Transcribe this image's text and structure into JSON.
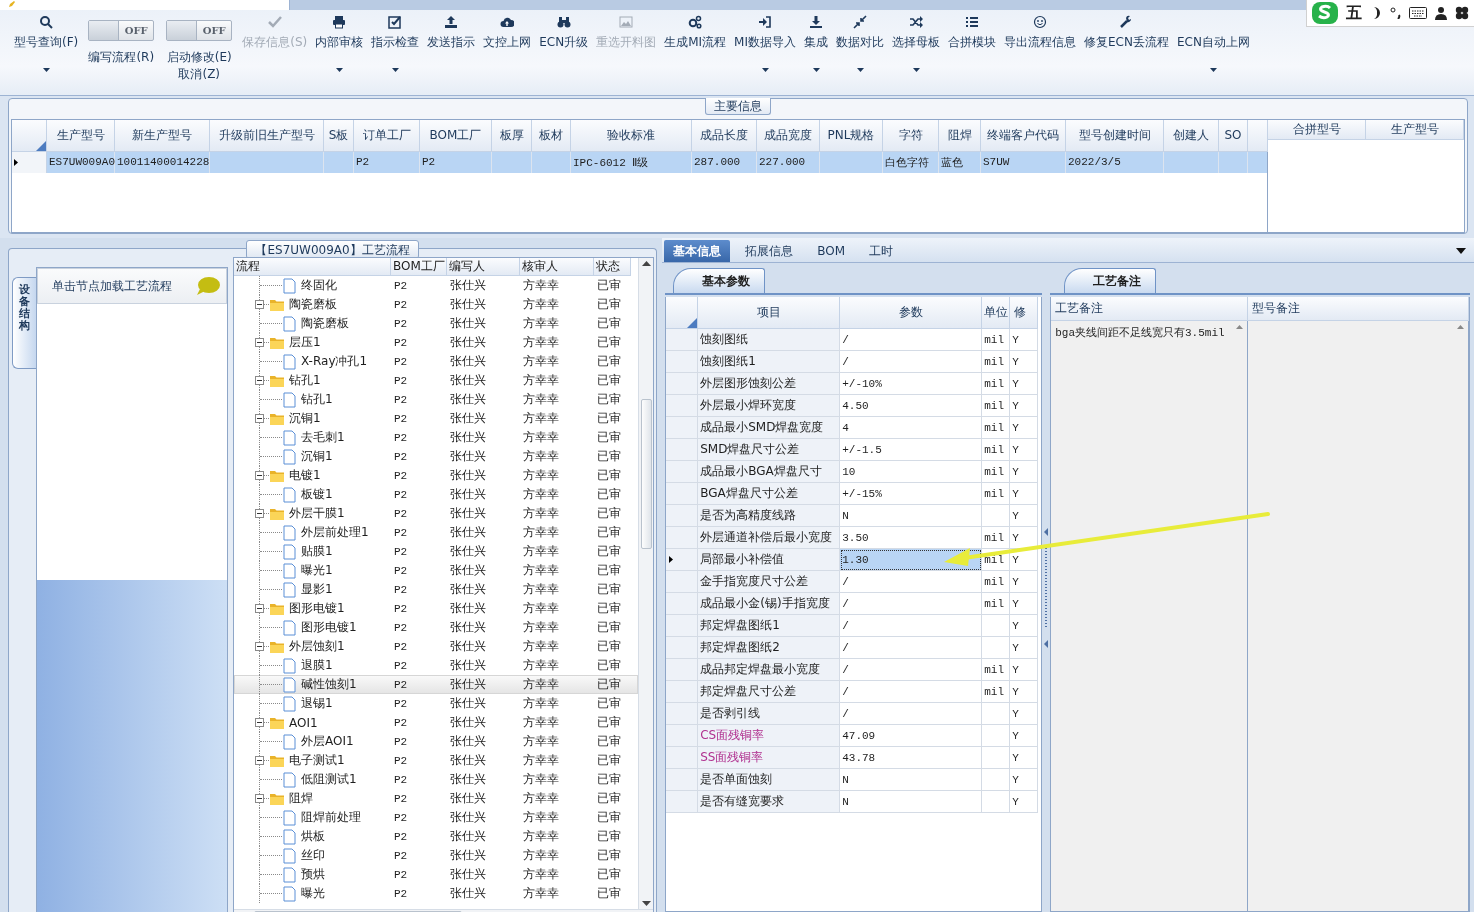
{
  "toolbar": {
    "items": [
      {
        "kind": "button",
        "label": "型号查询(F)",
        "dropdown": true,
        "disabled": false
      },
      {
        "kind": "toggle",
        "label": "编写流程(R)",
        "state_text": "OFF",
        "on": false
      },
      {
        "kind": "toggle",
        "label": "启动修改(E)",
        "sublabel": "取消(Z)",
        "state_text": "OFF",
        "on": false
      },
      {
        "kind": "button",
        "label": "保存信息(S)",
        "dropdown": false,
        "disabled": true
      },
      {
        "kind": "button",
        "label": "内部审核",
        "dropdown": true,
        "disabled": false
      },
      {
        "kind": "button",
        "label": "指示检查",
        "dropdown": true,
        "disabled": false
      },
      {
        "kind": "button",
        "label": "发送指示",
        "dropdown": false,
        "disabled": false
      },
      {
        "kind": "button",
        "label": "文控上网",
        "dropdown": false,
        "disabled": false
      },
      {
        "kind": "button",
        "label": "ECN升级",
        "dropdown": false,
        "disabled": false
      },
      {
        "kind": "button",
        "label": "重选开料图",
        "dropdown": false,
        "disabled": true
      },
      {
        "kind": "button",
        "label": "生成MI流程",
        "dropdown": false,
        "disabled": false
      },
      {
        "kind": "button",
        "label": "MI数据导入",
        "dropdown": true,
        "disabled": false
      },
      {
        "kind": "button",
        "label": "集成",
        "dropdown": true,
        "disabled": false
      },
      {
        "kind": "button",
        "label": "数据对比",
        "dropdown": true,
        "disabled": false
      },
      {
        "kind": "button",
        "label": "选择母板",
        "dropdown": true,
        "disabled": false
      },
      {
        "kind": "button",
        "label": "合拼模块",
        "dropdown": false,
        "disabled": false
      },
      {
        "kind": "button",
        "label": "导出流程信息",
        "dropdown": false,
        "disabled": false
      },
      {
        "kind": "button",
        "label": "修复ECN丢流程",
        "dropdown": false,
        "disabled": false
      },
      {
        "kind": "button",
        "label": "ECN自动上网",
        "dropdown": true,
        "disabled": false
      }
    ]
  },
  "ime_bar": {
    "mode": "五"
  },
  "main_info": {
    "title": "主要信息",
    "columns": [
      "生产型号",
      "新生产型号",
      "升级前旧生产型号",
      "S板",
      "订单工厂",
      "BOM工厂",
      "板厚",
      "板材",
      "验收标准",
      "成品长度",
      "成品宽度",
      "PNL规格",
      "字符",
      "阻焊",
      "终端客户代码",
      "型号创建时间",
      "创建人",
      "SO"
    ],
    "rows": [
      {
        "selected": true,
        "cells": [
          "ES7UW009A0",
          "10011400014228",
          null,
          null,
          "P2",
          "P2",
          null,
          null,
          "IPC-6012 Ⅱ级",
          "287.000",
          "227.000",
          null,
          "白色字符",
          "蓝色",
          "S7UW",
          "2022/3/5",
          null,
          null
        ]
      }
    ],
    "side_columns": [
      "合拼型号",
      "生产型号"
    ]
  },
  "process_flow": {
    "title": "【ES7UW009A0】工艺流程",
    "side_tab": "设备结构",
    "hint": "单击节点加载工艺流程",
    "columns": [
      "流程",
      "BOM工厂",
      "编写人",
      "核审人",
      "状态"
    ],
    "leading_rows": [
      {
        "name": "终固化",
        "kind": "file",
        "bom": "P2",
        "writer": "张仕兴",
        "reviewer": "方幸幸",
        "status": "已审",
        "selected": false
      }
    ],
    "nodes": [
      {
        "name": "陶瓷磨板",
        "kind": "folder",
        "expanded": true,
        "bom": "P2",
        "writer": "张仕兴",
        "reviewer": "方幸幸",
        "status": "已审",
        "selected": false,
        "children": [
          {
            "name": "陶瓷磨板",
            "kind": "file",
            "bom": "P2",
            "writer": "张仕兴",
            "reviewer": "方幸幸",
            "status": "已审",
            "selected": false
          }
        ]
      },
      {
        "name": "层压1",
        "kind": "folder",
        "expanded": true,
        "bom": "P2",
        "writer": "张仕兴",
        "reviewer": "方幸幸",
        "status": "已审",
        "selected": false,
        "children": [
          {
            "name": "X-Ray冲孔1",
            "kind": "file",
            "bom": "P2",
            "writer": "张仕兴",
            "reviewer": "方幸幸",
            "status": "已审",
            "selected": false
          }
        ]
      },
      {
        "name": "钻孔1",
        "kind": "folder",
        "expanded": true,
        "bom": "P2",
        "writer": "张仕兴",
        "reviewer": "方幸幸",
        "status": "已审",
        "selected": false,
        "children": [
          {
            "name": "钻孔1",
            "kind": "file",
            "bom": "P2",
            "writer": "张仕兴",
            "reviewer": "方幸幸",
            "status": "已审",
            "selected": false
          }
        ]
      },
      {
        "name": "沉铜1",
        "kind": "folder",
        "expanded": true,
        "bom": "P2",
        "writer": "张仕兴",
        "reviewer": "方幸幸",
        "status": "已审",
        "selected": false,
        "children": [
          {
            "name": "去毛刺1",
            "kind": "file",
            "bom": "P2",
            "writer": "张仕兴",
            "reviewer": "方幸幸",
            "status": "已审",
            "selected": false
          },
          {
            "name": "沉铜1",
            "kind": "file",
            "bom": "P2",
            "writer": "张仕兴",
            "reviewer": "方幸幸",
            "status": "已审",
            "selected": false
          }
        ]
      },
      {
        "name": "电镀1",
        "kind": "folder",
        "expanded": true,
        "bom": "P2",
        "writer": "张仕兴",
        "reviewer": "方幸幸",
        "status": "已审",
        "selected": false,
        "children": [
          {
            "name": "板镀1",
            "kind": "file",
            "bom": "P2",
            "writer": "张仕兴",
            "reviewer": "方幸幸",
            "status": "已审",
            "selected": false
          }
        ]
      },
      {
        "name": "外层干膜1",
        "kind": "folder",
        "expanded": true,
        "bom": "P2",
        "writer": "张仕兴",
        "reviewer": "方幸幸",
        "status": "已审",
        "selected": false,
        "children": [
          {
            "name": "外层前处理1",
            "kind": "file",
            "bom": "P2",
            "writer": "张仕兴",
            "reviewer": "方幸幸",
            "status": "已审",
            "selected": false
          },
          {
            "name": "贴膜1",
            "kind": "file",
            "bom": "P2",
            "writer": "张仕兴",
            "reviewer": "方幸幸",
            "status": "已审",
            "selected": false
          },
          {
            "name": "曝光1",
            "kind": "file",
            "bom": "P2",
            "writer": "张仕兴",
            "reviewer": "方幸幸",
            "status": "已审",
            "selected": false
          },
          {
            "name": "显影1",
            "kind": "file",
            "bom": "P2",
            "writer": "张仕兴",
            "reviewer": "方幸幸",
            "status": "已审",
            "selected": false
          }
        ]
      },
      {
        "name": "图形电镀1",
        "kind": "folder",
        "expanded": true,
        "bom": "P2",
        "writer": "张仕兴",
        "reviewer": "方幸幸",
        "status": "已审",
        "selected": false,
        "children": [
          {
            "name": "图形电镀1",
            "kind": "file",
            "bom": "P2",
            "writer": "张仕兴",
            "reviewer": "方幸幸",
            "status": "已审",
            "selected": false
          }
        ]
      },
      {
        "name": "外层蚀刻1",
        "kind": "folder",
        "expanded": true,
        "bom": "P2",
        "writer": "张仕兴",
        "reviewer": "方幸幸",
        "status": "已审",
        "selected": false,
        "children": [
          {
            "name": "退膜1",
            "kind": "file",
            "bom": "P2",
            "writer": "张仕兴",
            "reviewer": "方幸幸",
            "status": "已审",
            "selected": false
          },
          {
            "name": "碱性蚀刻1",
            "kind": "file",
            "bom": "P2",
            "writer": "张仕兴",
            "reviewer": "方幸幸",
            "status": "已审",
            "selected": true
          },
          {
            "name": "退锡1",
            "kind": "file",
            "bom": "P2",
            "writer": "张仕兴",
            "reviewer": "方幸幸",
            "status": "已审",
            "selected": false
          }
        ]
      },
      {
        "name": "AOI1",
        "kind": "folder",
        "expanded": true,
        "bom": "P2",
        "writer": "张仕兴",
        "reviewer": "方幸幸",
        "status": "已审",
        "selected": false,
        "children": [
          {
            "name": "外层AOI1",
            "kind": "file",
            "bom": "P2",
            "writer": "张仕兴",
            "reviewer": "方幸幸",
            "status": "已审",
            "selected": false
          }
        ]
      },
      {
        "name": "电子测试1",
        "kind": "folder",
        "expanded": true,
        "bom": "P2",
        "writer": "张仕兴",
        "reviewer": "方幸幸",
        "status": "已审",
        "selected": false,
        "children": [
          {
            "name": "低阻测试1",
            "kind": "file",
            "bom": "P2",
            "writer": "张仕兴",
            "reviewer": "方幸幸",
            "status": "已审",
            "selected": false
          }
        ]
      },
      {
        "name": "阻焊",
        "kind": "folder",
        "expanded": true,
        "bom": "P2",
        "writer": "张仕兴",
        "reviewer": "方幸幸",
        "status": "已审",
        "selected": false,
        "children": [
          {
            "name": "阻焊前处理",
            "kind": "file",
            "bom": "P2",
            "writer": "张仕兴",
            "reviewer": "方幸幸",
            "status": "已审",
            "selected": false
          },
          {
            "name": "烘板",
            "kind": "file",
            "bom": "P2",
            "writer": "张仕兴",
            "reviewer": "方幸幸",
            "status": "已审",
            "selected": false
          },
          {
            "name": "丝印",
            "kind": "file",
            "bom": "P2",
            "writer": "张仕兴",
            "reviewer": "方幸幸",
            "status": "已审",
            "selected": false
          },
          {
            "name": "预烘",
            "kind": "file",
            "bom": "P2",
            "writer": "张仕兴",
            "reviewer": "方幸幸",
            "status": "已审",
            "selected": false
          },
          {
            "name": "曝光",
            "kind": "file",
            "bom": "P2",
            "writer": "张仕兴",
            "reviewer": "方幸幸",
            "status": "已审",
            "selected": false
          }
        ]
      }
    ]
  },
  "detail": {
    "tabs": [
      {
        "label": "基本信息",
        "selected": true
      },
      {
        "label": "拓展信息",
        "selected": false
      },
      {
        "label": "BOM",
        "selected": false
      },
      {
        "label": "工时",
        "selected": false
      }
    ],
    "params": {
      "tab": "基本参数",
      "columns": [
        "项目",
        "参数",
        "单位",
        "修"
      ],
      "rows": [
        {
          "item": "蚀刻图纸",
          "value": "/",
          "unit": "mil",
          "flag": "Y",
          "highlighted": false,
          "selected": false
        },
        {
          "item": "蚀刻图纸1",
          "value": "/",
          "unit": "mil",
          "flag": "Y",
          "highlighted": false,
          "selected": false
        },
        {
          "item": "外层图形蚀刻公差",
          "value": "+/-10%",
          "unit": "mil",
          "flag": "Y",
          "highlighted": false,
          "selected": false
        },
        {
          "item": "外层最小焊环宽度",
          "value": "4.50",
          "unit": "mil",
          "flag": "Y",
          "highlighted": false,
          "selected": false
        },
        {
          "item": "成品最小SMD焊盘宽度",
          "value": "4",
          "unit": "mil",
          "flag": "Y",
          "highlighted": false,
          "selected": false
        },
        {
          "item": "SMD焊盘尺寸公差",
          "value": "+/-1.5",
          "unit": "mil",
          "flag": "Y",
          "highlighted": false,
          "selected": false
        },
        {
          "item": "成品最小BGA焊盘尺寸",
          "value": "10",
          "unit": "mil",
          "flag": "Y",
          "highlighted": false,
          "selected": false
        },
        {
          "item": "BGA焊盘尺寸公差",
          "value": "+/-15%",
          "unit": "mil",
          "flag": "Y",
          "highlighted": false,
          "selected": false
        },
        {
          "item": "是否为高精度线路",
          "value": "N",
          "flag": "Y",
          "highlighted": false,
          "selected": false
        },
        {
          "item": "外层通道补偿后最小宽度",
          "value": "3.50",
          "unit": "mil",
          "flag": "Y",
          "highlighted": false,
          "selected": false
        },
        {
          "item": "局部最小补偿值",
          "value": "1.30",
          "unit": "mil",
          "flag": "Y",
          "highlighted": false,
          "selected": true
        },
        {
          "item": "金手指宽度尺寸公差",
          "value": "/",
          "unit": "mil",
          "flag": "Y",
          "highlighted": false,
          "selected": false
        },
        {
          "item": "成品最小金(锡)手指宽度",
          "value": "/",
          "unit": "mil",
          "flag": "Y",
          "highlighted": false,
          "selected": false
        },
        {
          "item": "邦定焊盘图纸1",
          "value": "/",
          "flag": "Y",
          "highlighted": false,
          "selected": false
        },
        {
          "item": "邦定焊盘图纸2",
          "value": "/",
          "flag": "Y",
          "highlighted": false,
          "selected": false
        },
        {
          "item": "成品邦定焊盘最小宽度",
          "value": "/",
          "unit": "mil",
          "flag": "Y",
          "highlighted": false,
          "selected": false
        },
        {
          "item": "邦定焊盘尺寸公差",
          "value": "/",
          "unit": "mil",
          "flag": "Y",
          "highlighted": false,
          "selected": false
        },
        {
          "item": "是否剥引线",
          "value": "/",
          "flag": "Y",
          "highlighted": false,
          "selected": false
        },
        {
          "item": "CS面残铜率",
          "value": "47.09",
          "flag": "Y",
          "highlighted": true,
          "selected": false
        },
        {
          "item": "SS面残铜率",
          "value": "43.78",
          "flag": "Y",
          "highlighted": true,
          "selected": false
        },
        {
          "item": "是否单面蚀刻",
          "value": "N",
          "flag": "Y",
          "highlighted": false,
          "selected": false
        },
        {
          "item": "是否有缝宽要求",
          "value": "N",
          "flag": "Y",
          "highlighted": false,
          "selected": false
        }
      ]
    },
    "notes": {
      "tab": "工艺备注",
      "columns": [
        "工艺备注",
        "型号备注"
      ],
      "process_note": "bga夹线间距不足线宽只有3.5mil"
    }
  }
}
